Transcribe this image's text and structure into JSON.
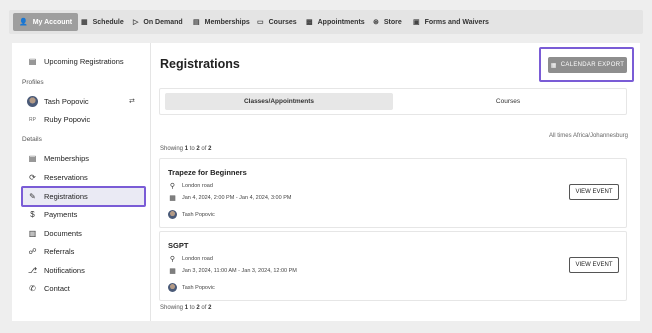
{
  "topnav": {
    "items": [
      {
        "label": "My Account",
        "icon": "user-icon"
      },
      {
        "label": "Schedule",
        "icon": "calendar-icon"
      },
      {
        "label": "On Demand",
        "icon": "video-icon"
      },
      {
        "label": "Memberships",
        "icon": "card-icon"
      },
      {
        "label": "Courses",
        "icon": "ticket-icon"
      },
      {
        "label": "Appointments",
        "icon": "calendar-check-icon"
      },
      {
        "label": "Store",
        "icon": "cart-icon"
      },
      {
        "label": "Forms and Waivers",
        "icon": "folder-icon"
      }
    ]
  },
  "sidebar": {
    "upcoming": "Upcoming Registrations",
    "profiles_heading": "Profiles",
    "profiles": [
      {
        "name": "Tash Popovic"
      },
      {
        "name": "Ruby Popovic",
        "initials": "RP"
      }
    ],
    "details_heading": "Details",
    "details": [
      {
        "label": "Memberships",
        "icon": "id-card-icon"
      },
      {
        "label": "Reservations",
        "icon": "refresh-icon"
      },
      {
        "label": "Registrations",
        "icon": "edit-list-icon"
      },
      {
        "label": "Payments",
        "icon": "dollar-icon"
      },
      {
        "label": "Documents",
        "icon": "document-icon"
      },
      {
        "label": "Referrals",
        "icon": "handshake-icon"
      },
      {
        "label": "Notifications",
        "icon": "bell-icon"
      },
      {
        "label": "Contact",
        "icon": "phone-icon"
      }
    ]
  },
  "main": {
    "title": "Registrations",
    "export_label": "CALENDAR EXPORT",
    "tabs": [
      {
        "label": "Classes/Appointments"
      },
      {
        "label": "Courses"
      }
    ],
    "timezone": "All times Africa/Johannesburg",
    "showing": {
      "prefix": "Showing",
      "from": "1",
      "to_word": "to",
      "to": "2",
      "of_word": "of",
      "total": "2"
    },
    "events": [
      {
        "title": "Trapeze for Beginners",
        "location": "London road",
        "time": "Jan 4, 2024, 2:00 PM - Jan 4, 2024, 3:00 PM",
        "person": "Tash Popovic",
        "button": "VIEW EVENT"
      },
      {
        "title": "SGPT",
        "location": "London road",
        "time": "Jan 3, 2024, 11:00 AM - Jan 3, 2024, 12:00 PM",
        "person": "Tash Popovic",
        "button": "VIEW EVENT"
      }
    ]
  },
  "colors": {
    "highlight": "#7a5cd6",
    "active_nav": "#9e9e9e",
    "export_button": "#8e8e8e"
  }
}
